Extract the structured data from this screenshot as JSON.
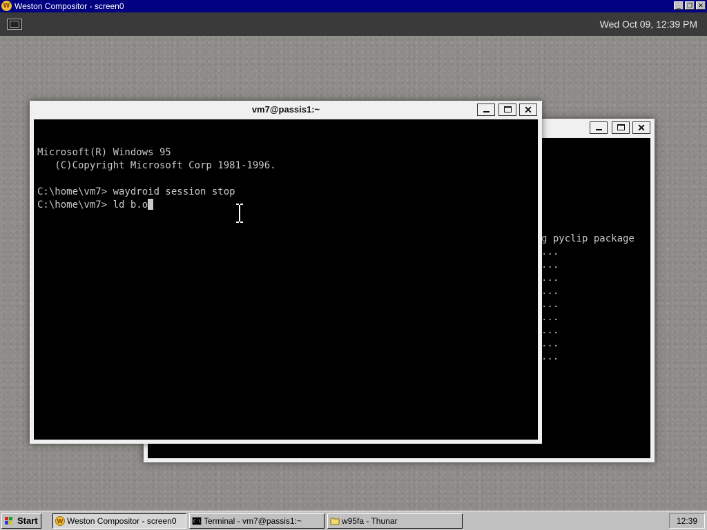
{
  "outer_window": {
    "title": "Weston Compositor - screen0",
    "logo": "W"
  },
  "panel": {
    "launcher_icon": "terminal-launcher-icon",
    "clock": "Wed Oct 09, 12:39 PM"
  },
  "back_window": {
    "visible_lines": [
      "g pyclip package",
      "...",
      "...",
      "...",
      "...",
      "...",
      "...",
      "...",
      "...",
      "..."
    ]
  },
  "front_window": {
    "title": "vm7@passis1:~",
    "lines": [
      "",
      "Microsoft(R) Windows 95",
      "   (C)Copyright Microsoft Corp 1981-1996.",
      "",
      "C:\\home\\vm7> waydroid session stop"
    ],
    "prompt": "C:\\home\\vm7> ",
    "input": "ld b.o"
  },
  "taskbar": {
    "start_label": "Start",
    "tasks": [
      {
        "label": "Weston Compositor - screen0",
        "icon": "weston-icon",
        "pressed": true
      },
      {
        "label": "Terminal - vm7@passis1:~",
        "icon": "terminal-icon",
        "pressed": false
      },
      {
        "label": "w95fa - Thunar",
        "icon": "folder-icon",
        "pressed": false
      }
    ],
    "tray_clock": "12:39"
  },
  "colors": {
    "title_bar": "#000080",
    "panel": "#3a3a3a",
    "desktop": "#8e8c88",
    "terminal_bg": "#000000",
    "terminal_fg": "#c8c8c8"
  }
}
